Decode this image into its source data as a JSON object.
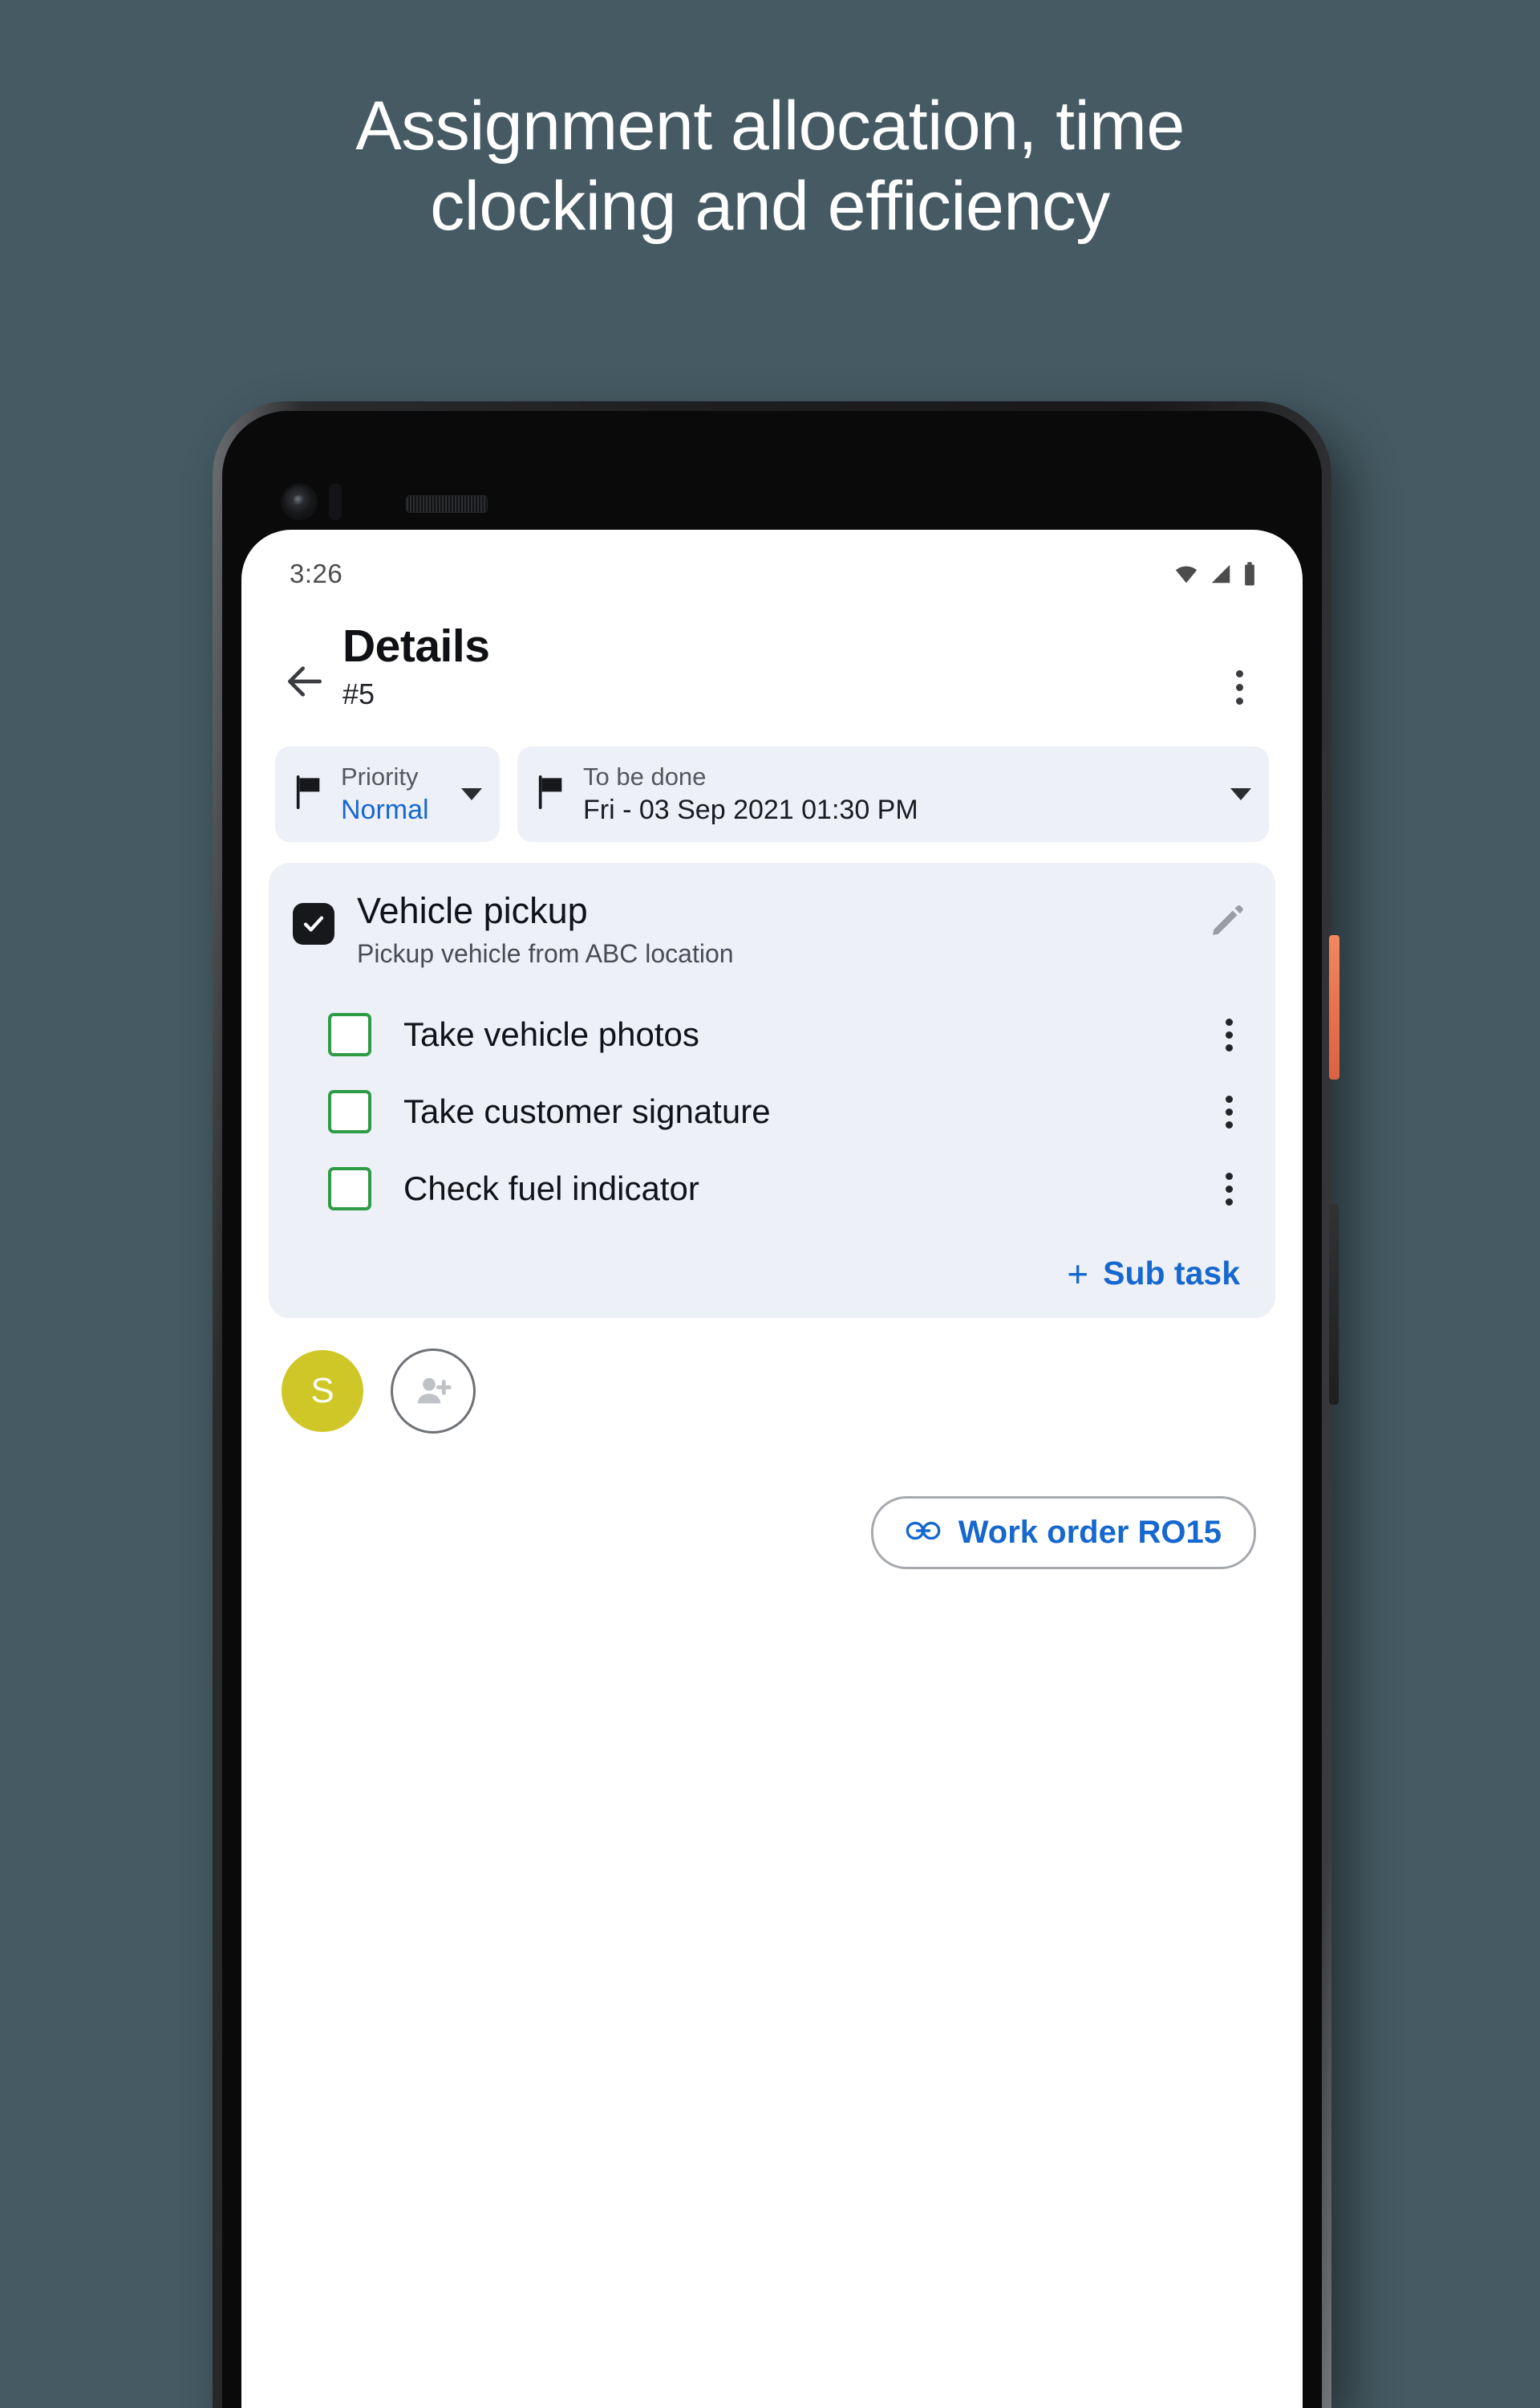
{
  "promo": {
    "headline_line1": "Assignment allocation, time",
    "headline_line2": "clocking and efficiency",
    "background_color": "#455a63",
    "text_color": "#ffffff"
  },
  "device": {
    "power_button_color": "#e8734c",
    "frame_color": "#1b1c1e"
  },
  "status_bar": {
    "time": "3:26",
    "icons": [
      "wifi-icon",
      "signal-icon",
      "battery-icon"
    ]
  },
  "app_bar": {
    "back_icon": "arrow-left-icon",
    "title": "Details",
    "subtitle": "#5",
    "overflow_icon": "more-vertical-icon"
  },
  "chips": {
    "priority": {
      "icon": "flag-icon",
      "label": "Priority",
      "value": "Normal",
      "value_color": "#1668cf",
      "caret": "chevron-down-icon"
    },
    "due": {
      "icon": "flag-icon",
      "label": "To be done",
      "value": "Fri - 03 Sep 2021 01:30 PM",
      "caret": "chevron-down-icon"
    }
  },
  "task_card": {
    "background_color": "#eef0f8",
    "checkbox_state": "checked",
    "title": "Vehicle pickup",
    "description": "Pickup vehicle from ABC location",
    "edit_icon": "pencil-icon",
    "subtasks": [
      {
        "label": "Take vehicle photos",
        "checked": false,
        "menu_icon": "more-vertical-icon"
      },
      {
        "label": "Take customer signature",
        "checked": false,
        "menu_icon": "more-vertical-icon"
      },
      {
        "label": "Check fuel indicator",
        "checked": false,
        "menu_icon": "more-vertical-icon"
      }
    ],
    "subtask_checkbox_color": "#2e9b45",
    "add_subtask": {
      "plus": "+",
      "label": "Sub task",
      "color": "#1668cf"
    }
  },
  "assignees": {
    "avatar": {
      "initial": "S",
      "color": "#cfc628"
    },
    "add_button_icon": "person-add-icon"
  },
  "work_order": {
    "icon": "link-icon",
    "label": "Work order RO15",
    "color": "#1668cf"
  }
}
